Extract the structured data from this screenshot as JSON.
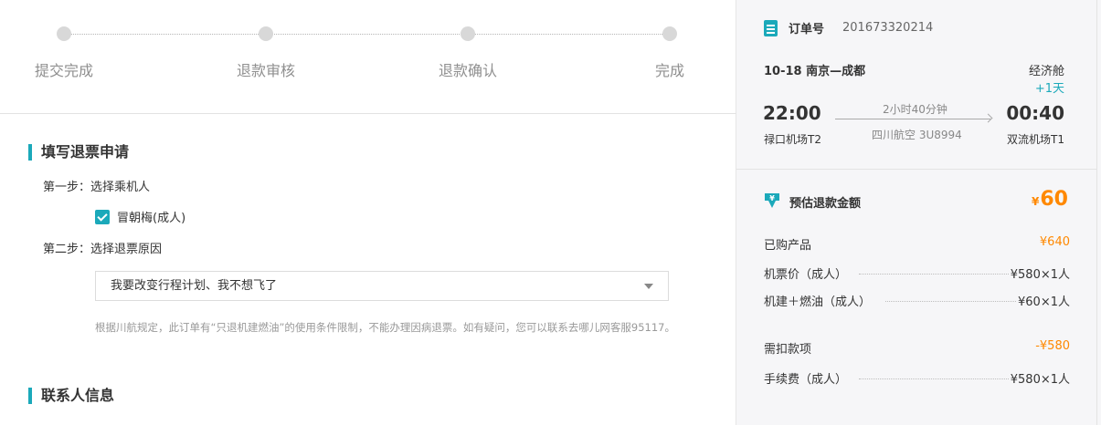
{
  "steps": [
    "提交完成",
    "退款审核",
    "退款确认",
    "完成"
  ],
  "form": {
    "title": "填写退票申请",
    "step1": "第一步：选择乘机人",
    "passenger": "冒朝梅(成人)",
    "step2": "第二步：选择退票原因",
    "reason": "我要改变行程计划、我不想飞了",
    "note": "根据川航规定，此订单有“只退机建燃油”的使用条件限制，不能办理因病退票。如有疑问，您可以联系去哪儿网客服95117。"
  },
  "contact": {
    "title": "联系人信息"
  },
  "order": {
    "label": "订单号",
    "number": "201673320214",
    "date_route": "10-18  南京—成都",
    "cabin": "经济舱",
    "next_day": "+1天",
    "dep_time": "22:00",
    "arr_time": "00:40",
    "duration": "2小时40分钟",
    "dep_airport": "禄口机场T2",
    "arr_airport": "双流机场T1",
    "flight": "四川航空 3U8994"
  },
  "refund": {
    "title": "预估退款金额",
    "currency": "¥",
    "amount": "60",
    "purchased_label": "已购产品",
    "purchased_value": "¥640",
    "ticket_label": "机票价（成人）",
    "ticket_value": "¥580×1人",
    "tax_label": "机建＋燃油（成人）",
    "tax_value": "¥60×1人",
    "deduct_label": "需扣款项",
    "deduct_value": "-¥580",
    "fee_label": "手续费（成人）",
    "fee_value": "¥580×1人"
  },
  "colors": {
    "accent": "#1ba9ba",
    "price": "#ff8800",
    "step_dot": "#d8d8d8"
  },
  "icons": {
    "order": "document-icon",
    "refund": "refund-down-arrow-icon",
    "check": "checkbox-checked-icon",
    "dropdown": "caret-down-icon"
  }
}
